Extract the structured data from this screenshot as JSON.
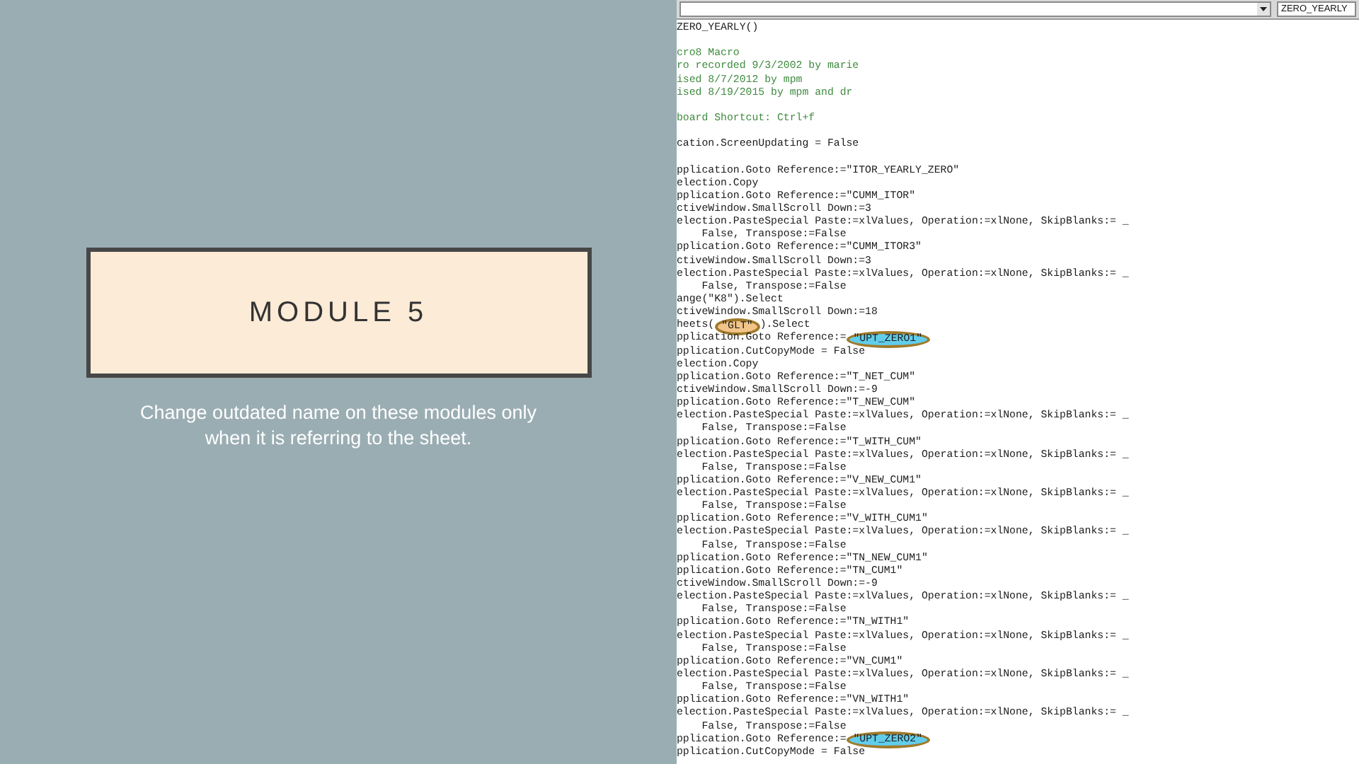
{
  "slide": {
    "title": "MODULE 5",
    "caption": "Change outdated name on these modules only when it is referring to the sheet."
  },
  "editor": {
    "procedure_dropdown": {
      "kind": "dropdown"
    },
    "name_field": {
      "value": "ZERO_YEARLY"
    },
    "lines": [
      {
        "kind": "code",
        "segments": [
          {
            "text": "ZERO_YEARLY()"
          }
        ]
      },
      {
        "kind": "blank"
      },
      {
        "kind": "comment",
        "segments": [
          {
            "text": "cro8 Macro"
          }
        ]
      },
      {
        "kind": "comment",
        "segments": [
          {
            "text": "ro recorded 9/3/2002 by marie"
          }
        ]
      },
      {
        "kind": "comment",
        "segments": [
          {
            "text": "ised 8/7/2012 by mpm"
          }
        ]
      },
      {
        "kind": "comment",
        "segments": [
          {
            "text": "ised 8/19/2015 by mpm and dr"
          }
        ]
      },
      {
        "kind": "blank"
      },
      {
        "kind": "comment",
        "segments": [
          {
            "text": "board Shortcut: Ctrl+f"
          }
        ]
      },
      {
        "kind": "blank"
      },
      {
        "kind": "code",
        "segments": [
          {
            "text": "cation.ScreenUpdating = False"
          }
        ]
      },
      {
        "kind": "blank"
      },
      {
        "kind": "code",
        "segments": [
          {
            "text": "pplication.Goto Reference:=\"ITOR_YEARLY_ZERO\""
          }
        ]
      },
      {
        "kind": "code",
        "segments": [
          {
            "text": "election.Copy"
          }
        ]
      },
      {
        "kind": "code",
        "segments": [
          {
            "text": "pplication.Goto Reference:=\"CUMM_ITOR\""
          }
        ]
      },
      {
        "kind": "code",
        "segments": [
          {
            "text": "ctiveWindow.SmallScroll Down:=3"
          }
        ]
      },
      {
        "kind": "code",
        "segments": [
          {
            "text": "election.PasteSpecial Paste:=xlValues, Operation:=xlNone, SkipBlanks:= _"
          }
        ]
      },
      {
        "kind": "code",
        "segments": [
          {
            "text": "    False, Transpose:=False"
          }
        ]
      },
      {
        "kind": "code",
        "segments": [
          {
            "text": "pplication.Goto Reference:=\"CUMM_ITOR3\""
          }
        ]
      },
      {
        "kind": "code",
        "segments": [
          {
            "text": "ctiveWindow.SmallScroll Down:=3"
          }
        ]
      },
      {
        "kind": "code",
        "segments": [
          {
            "text": "election.PasteSpecial Paste:=xlValues, Operation:=xlNone, SkipBlanks:= _"
          }
        ]
      },
      {
        "kind": "code",
        "segments": [
          {
            "text": "    False, Transpose:=False"
          }
        ]
      },
      {
        "kind": "code",
        "segments": [
          {
            "text": "ange(\"K8\").Select"
          }
        ]
      },
      {
        "kind": "code",
        "segments": [
          {
            "text": "ctiveWindow.SmallScroll Down:=18"
          }
        ]
      },
      {
        "kind": "code",
        "segments": [
          {
            "text": "heets("
          },
          {
            "text": "\"GLT\"",
            "color": "#f2c48a"
          },
          {
            "text": ").Select"
          }
        ]
      },
      {
        "kind": "code",
        "segments": [
          {
            "text": "pplication.Goto Reference:="
          },
          {
            "text": "\"UPT_ZERO1\"",
            "color": "#62cdea"
          }
        ]
      },
      {
        "kind": "code",
        "segments": [
          {
            "text": "pplication.CutCopyMode = False"
          }
        ]
      },
      {
        "kind": "code",
        "segments": [
          {
            "text": "election.Copy"
          }
        ]
      },
      {
        "kind": "code",
        "segments": [
          {
            "text": "pplication.Goto Reference:=\"T_NET_CUM\""
          }
        ]
      },
      {
        "kind": "code",
        "segments": [
          {
            "text": "ctiveWindow.SmallScroll Down:=-9"
          }
        ]
      },
      {
        "kind": "code",
        "segments": [
          {
            "text": "pplication.Goto Reference:=\"T_NEW_CUM\""
          }
        ]
      },
      {
        "kind": "code",
        "segments": [
          {
            "text": "election.PasteSpecial Paste:=xlValues, Operation:=xlNone, SkipBlanks:= _"
          }
        ]
      },
      {
        "kind": "code",
        "segments": [
          {
            "text": "    False, Transpose:=False"
          }
        ]
      },
      {
        "kind": "code",
        "segments": [
          {
            "text": "pplication.Goto Reference:=\"T_WITH_CUM\""
          }
        ]
      },
      {
        "kind": "code",
        "segments": [
          {
            "text": "election.PasteSpecial Paste:=xlValues, Operation:=xlNone, SkipBlanks:= _"
          }
        ]
      },
      {
        "kind": "code",
        "segments": [
          {
            "text": "    False, Transpose:=False"
          }
        ]
      },
      {
        "kind": "code",
        "segments": [
          {
            "text": "pplication.Goto Reference:=\"V_NEW_CUM1\""
          }
        ]
      },
      {
        "kind": "code",
        "segments": [
          {
            "text": "election.PasteSpecial Paste:=xlValues, Operation:=xlNone, SkipBlanks:= _"
          }
        ]
      },
      {
        "kind": "code",
        "segments": [
          {
            "text": "    False, Transpose:=False"
          }
        ]
      },
      {
        "kind": "code",
        "segments": [
          {
            "text": "pplication.Goto Reference:=\"V_WITH_CUM1\""
          }
        ]
      },
      {
        "kind": "code",
        "segments": [
          {
            "text": "election.PasteSpecial Paste:=xlValues, Operation:=xlNone, SkipBlanks:= _"
          }
        ]
      },
      {
        "kind": "code",
        "segments": [
          {
            "text": "    False, Transpose:=False"
          }
        ]
      },
      {
        "kind": "code",
        "segments": [
          {
            "text": "pplication.Goto Reference:=\"TN_NEW_CUM1\""
          }
        ]
      },
      {
        "kind": "code",
        "segments": [
          {
            "text": "pplication.Goto Reference:=\"TN_CUM1\""
          }
        ]
      },
      {
        "kind": "code",
        "segments": [
          {
            "text": "ctiveWindow.SmallScroll Down:=-9"
          }
        ]
      },
      {
        "kind": "code",
        "segments": [
          {
            "text": "election.PasteSpecial Paste:=xlValues, Operation:=xlNone, SkipBlanks:= _"
          }
        ]
      },
      {
        "kind": "code",
        "segments": [
          {
            "text": "    False, Transpose:=False"
          }
        ]
      },
      {
        "kind": "code",
        "segments": [
          {
            "text": "pplication.Goto Reference:=\"TN_WITH1\""
          }
        ]
      },
      {
        "kind": "code",
        "segments": [
          {
            "text": "election.PasteSpecial Paste:=xlValues, Operation:=xlNone, SkipBlanks:= _"
          }
        ]
      },
      {
        "kind": "code",
        "segments": [
          {
            "text": "    False, Transpose:=False"
          }
        ]
      },
      {
        "kind": "code",
        "segments": [
          {
            "text": "pplication.Goto Reference:=\"VN_CUM1\""
          }
        ]
      },
      {
        "kind": "code",
        "segments": [
          {
            "text": "election.PasteSpecial Paste:=xlValues, Operation:=xlNone, SkipBlanks:= _"
          }
        ]
      },
      {
        "kind": "code",
        "segments": [
          {
            "text": "    False, Transpose:=False"
          }
        ]
      },
      {
        "kind": "code",
        "segments": [
          {
            "text": "pplication.Goto Reference:=\"VN_WITH1\""
          }
        ]
      },
      {
        "kind": "code",
        "segments": [
          {
            "text": "election.PasteSpecial Paste:=xlValues, Operation:=xlNone, SkipBlanks:= _"
          }
        ]
      },
      {
        "kind": "code",
        "segments": [
          {
            "text": "    False, Transpose:=False"
          }
        ]
      },
      {
        "kind": "code",
        "segments": [
          {
            "text": "pplication.Goto Reference:="
          },
          {
            "text": "\"UPT_ZERO2\"",
            "color": "#62cdea"
          }
        ]
      },
      {
        "kind": "code",
        "segments": [
          {
            "text": "pplication.CutCopyMode = False"
          }
        ]
      }
    ]
  }
}
